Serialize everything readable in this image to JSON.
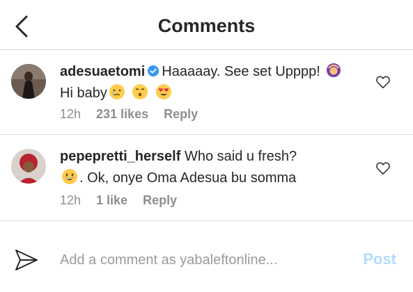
{
  "header": {
    "title": "Comments",
    "back_icon": "chevron-left-icon"
  },
  "comments": [
    {
      "username": "adesuaetomi",
      "verified": true,
      "text_part1": "Haaaaay. See set Upppp!",
      "text_part2": "Hi baby",
      "emojis": [
        "woman-gesturing-ok",
        "crying-face",
        "kissing-face",
        "heart-eyes"
      ],
      "time": "12h",
      "likes": "231 likes",
      "reply": "Reply"
    },
    {
      "username": "pepepretti_herself",
      "text_part1": "Who said u fresh?",
      "text_part2": ". Ok, onye Oma Adesua bu somma",
      "emojis": [
        "grinning-face"
      ],
      "time": "12h",
      "likes": "1 like",
      "reply": "Reply"
    }
  ],
  "composer": {
    "placeholder": "Add a comment as yabaleftonline...",
    "value": "",
    "post_label": "Post",
    "send_icon": "paper-plane-icon"
  },
  "colors": {
    "text": "#262626",
    "muted": "#8e8e8e",
    "divider": "#dbdbdb",
    "post_disabled": "#b3dbff",
    "verified": "#3897f0"
  }
}
